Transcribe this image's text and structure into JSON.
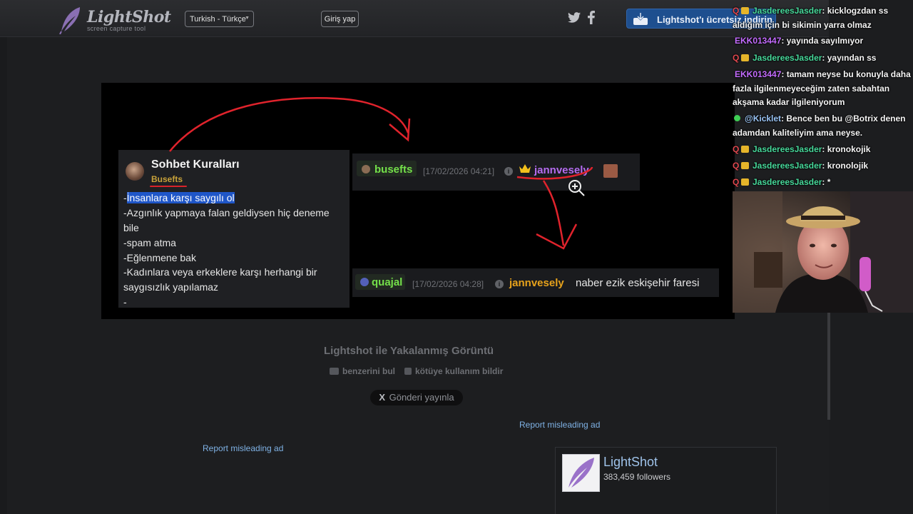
{
  "header": {
    "logo_title": "LightShot",
    "logo_subtitle": "screen capture tool",
    "language": "Turkish - Türkçe",
    "login": "Giriş yap",
    "download": "Lightshot'ı ücretsiz indirin"
  },
  "screenshot": {
    "rules": {
      "title": "Sohbet Kuralları",
      "author": "Busefts",
      "lines": [
        "-",
        "İnsanlara karşı saygılı ol",
        "-Azgınlık yapmaya falan geldiysen hiç deneme",
        "bile",
        "-spam atma",
        "-Eğlenmene bak",
        "-Kadınlara veya erkeklere karşı herhangi bir",
        "saygısızlık yapılamaz",
        "-"
      ]
    },
    "msg1": {
      "user": "busefts",
      "timestamp": "[17/02/2026 04:21]",
      "target": "jannvesely"
    },
    "msg2": {
      "user": "quajal",
      "timestamp": "[17/02/2026 04:28]",
      "target": "jannvesely",
      "text": "naber ezik eskişehir faresi"
    }
  },
  "footer": {
    "caption": "Lightshot ile Yakalanmış Görüntü",
    "find_similar": "benzerini bul",
    "report_abuse": "kötüye kullanım bildir",
    "post_button": "Gönderi yayınla",
    "post_x": "X",
    "ad_report_right": "Report misleading ad",
    "ad_report_left": "Report misleading ad",
    "fb_name": "LightShot",
    "fb_followers": "383,459 followers"
  },
  "chat": [
    {
      "mod": "Q",
      "sub": true,
      "user": "JasdereesJasder",
      "color": "green",
      "text": ": kicklogzdan ss aldığım için bi sikimin yarra olmaz"
    },
    {
      "mod": "",
      "sub": false,
      "user": "EKK013447",
      "color": "purple",
      "text": ": yayında sayılmıyor"
    },
    {
      "mod": "Q",
      "sub": true,
      "user": "JasdereesJasder",
      "color": "green",
      "text": ": yayından ss"
    },
    {
      "mod": "",
      "sub": false,
      "user": "EKK013447",
      "color": "purple",
      "text": ": tamam neyse bu konuyla daha fazla ilgilenmeyeceğim zaten sabahtan akşama kadar ilgileniyorum"
    },
    {
      "mod": "",
      "sub": false,
      "verified": true,
      "user": "@Kicklet",
      "color": "blue",
      "text": ": Bence ben bu @Botrix denen adamdan kaliteliyim ama neyse."
    },
    {
      "mod": "Q",
      "sub": true,
      "user": "JasdereesJasder",
      "color": "green",
      "text": ": kronokojik"
    },
    {
      "mod": "Q",
      "sub": true,
      "user": "JasdereesJasder",
      "color": "green",
      "text": ": kronolojik"
    },
    {
      "mod": "Q",
      "sub": true,
      "user": "JasdereesJasder",
      "color": "green",
      "text": ": *"
    }
  ],
  "colors": {
    "accent_red": "#d8232a",
    "name_green": "#47d99b",
    "name_purple": "#c46cff",
    "jann_orange": "#e7a21b",
    "busefts_green": "#74e04a",
    "download_blue": "#1e4f8f"
  }
}
